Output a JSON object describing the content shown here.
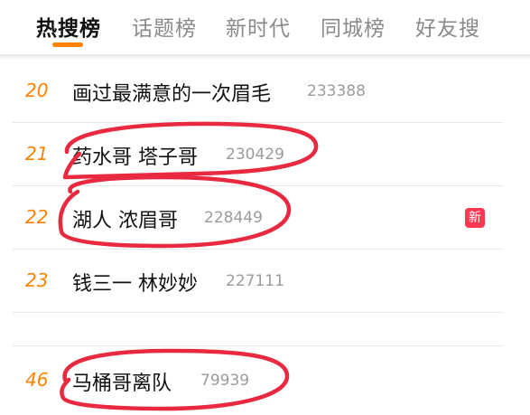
{
  "tabs": [
    {
      "label": "热搜榜",
      "active": true
    },
    {
      "label": "话题榜",
      "active": false
    },
    {
      "label": "新时代",
      "active": false
    },
    {
      "label": "同城榜",
      "active": false
    },
    {
      "label": "好友搜",
      "active": false
    }
  ],
  "rows": [
    {
      "rank": "20",
      "title": "画过最满意的一次眉毛",
      "count": "233388"
    },
    {
      "rank": "21",
      "title": "药水哥 塔子哥",
      "count": "230429"
    },
    {
      "rank": "22",
      "title": "湖人 浓眉哥",
      "count": "228449",
      "badge": "新"
    },
    {
      "rank": "23",
      "title": "钱三一 林妙妙",
      "count": "227111"
    },
    {
      "rank": "46",
      "title": "马桶哥离队",
      "count": "79939"
    }
  ],
  "colors": {
    "accent": "#ff8200",
    "badge": "#ff3852",
    "annotation": "#e8293f"
  }
}
